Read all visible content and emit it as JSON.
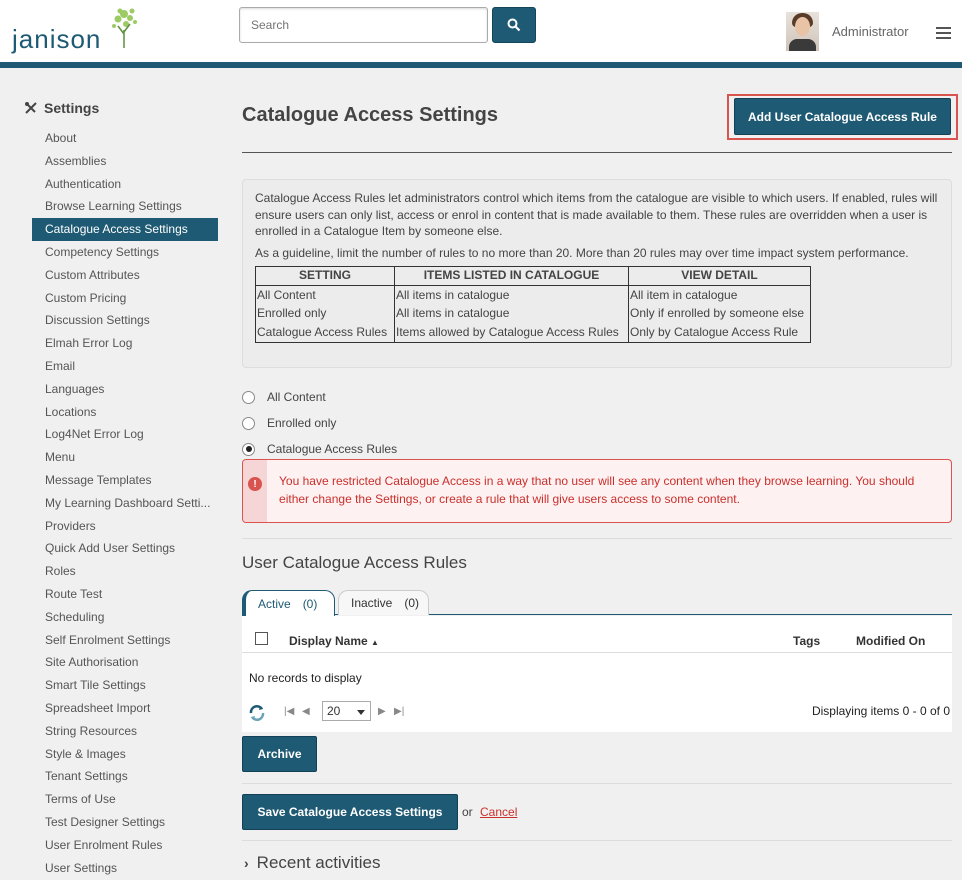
{
  "header": {
    "logo_text": "janison",
    "search_placeholder": "Search",
    "user_name": "Administrator"
  },
  "sidebar": {
    "title": "Settings",
    "items": [
      {
        "label": "About"
      },
      {
        "label": "Assemblies"
      },
      {
        "label": "Authentication"
      },
      {
        "label": "Browse Learning Settings"
      },
      {
        "label": "Catalogue Access Settings",
        "active": true
      },
      {
        "label": "Competency Settings"
      },
      {
        "label": "Custom Attributes"
      },
      {
        "label": "Custom Pricing"
      },
      {
        "label": "Discussion Settings"
      },
      {
        "label": "Elmah Error Log"
      },
      {
        "label": "Email"
      },
      {
        "label": "Languages"
      },
      {
        "label": "Locations"
      },
      {
        "label": "Log4Net Error Log"
      },
      {
        "label": "Menu"
      },
      {
        "label": "Message Templates"
      },
      {
        "label": "My Learning Dashboard Setti..."
      },
      {
        "label": "Providers"
      },
      {
        "label": "Quick Add User Settings"
      },
      {
        "label": "Roles"
      },
      {
        "label": "Route Test"
      },
      {
        "label": "Scheduling"
      },
      {
        "label": "Self Enrolment Settings"
      },
      {
        "label": "Site Authorisation"
      },
      {
        "label": "Smart Tile Settings"
      },
      {
        "label": "Spreadsheet Import"
      },
      {
        "label": "String Resources"
      },
      {
        "label": "Style & Images"
      },
      {
        "label": "Tenant Settings"
      },
      {
        "label": "Terms of Use"
      },
      {
        "label": "Test Designer Settings"
      },
      {
        "label": "User Enrolment Rules"
      },
      {
        "label": "User Settings"
      }
    ]
  },
  "main": {
    "title": "Catalogue Access Settings",
    "add_rule_label": "Add User Catalogue Access Rule",
    "info": {
      "para1": "Catalogue Access Rules let administrators control which items from the catalogue are visible to which users. If enabled, rules will ensure users can only list, access or enrol in content that is made available to them. These rules are overridden when a user is enrolled in a Catalogue Item by someone else.",
      "para2": "As a guideline, limit the number of rules to no more than 20. More than 20 rules may over time impact system performance.",
      "table_headers": [
        "SETTING",
        "ITEMS LISTED IN CATALOGUE",
        "VIEW DETAIL"
      ],
      "table_rows": [
        [
          "All Content",
          "All items in catalogue",
          "All item in catalogue"
        ],
        [
          "Enrolled only",
          "All items in catalogue",
          "Only if enrolled by someone else"
        ],
        [
          "Catalogue Access Rules",
          "Items allowed by Catalogue Access Rules",
          "Only by Catalogue Access Rule"
        ]
      ]
    },
    "options": [
      {
        "label": "All Content",
        "checked": false
      },
      {
        "label": "Enrolled only",
        "checked": false
      },
      {
        "label": "Catalogue Access Rules",
        "checked": true
      }
    ],
    "alert_text": "You have restricted Catalogue Access in a way that no user will see any content when they browse learning. You should either change the Settings, or create a rule that will give users access to some content.",
    "rules_title": "User Catalogue Access Rules",
    "tabs": [
      {
        "label": "Active",
        "count": "(0)"
      },
      {
        "label": "Inactive",
        "count": "(0)"
      }
    ],
    "grid": {
      "col_name": "Display Name",
      "col_tags": "Tags",
      "col_modified": "Modified On",
      "empty_text": "No records to display",
      "page_size": "20",
      "paging_info": "Displaying items 0 - 0 of 0"
    },
    "archive_label": "Archive",
    "save_label": "Save Catalogue Access Settings",
    "or_text": "or",
    "cancel_label": "Cancel",
    "recent_label": "Recent activities"
  },
  "colors": {
    "brand": "#1e5a73",
    "alert": "#d9534f"
  }
}
